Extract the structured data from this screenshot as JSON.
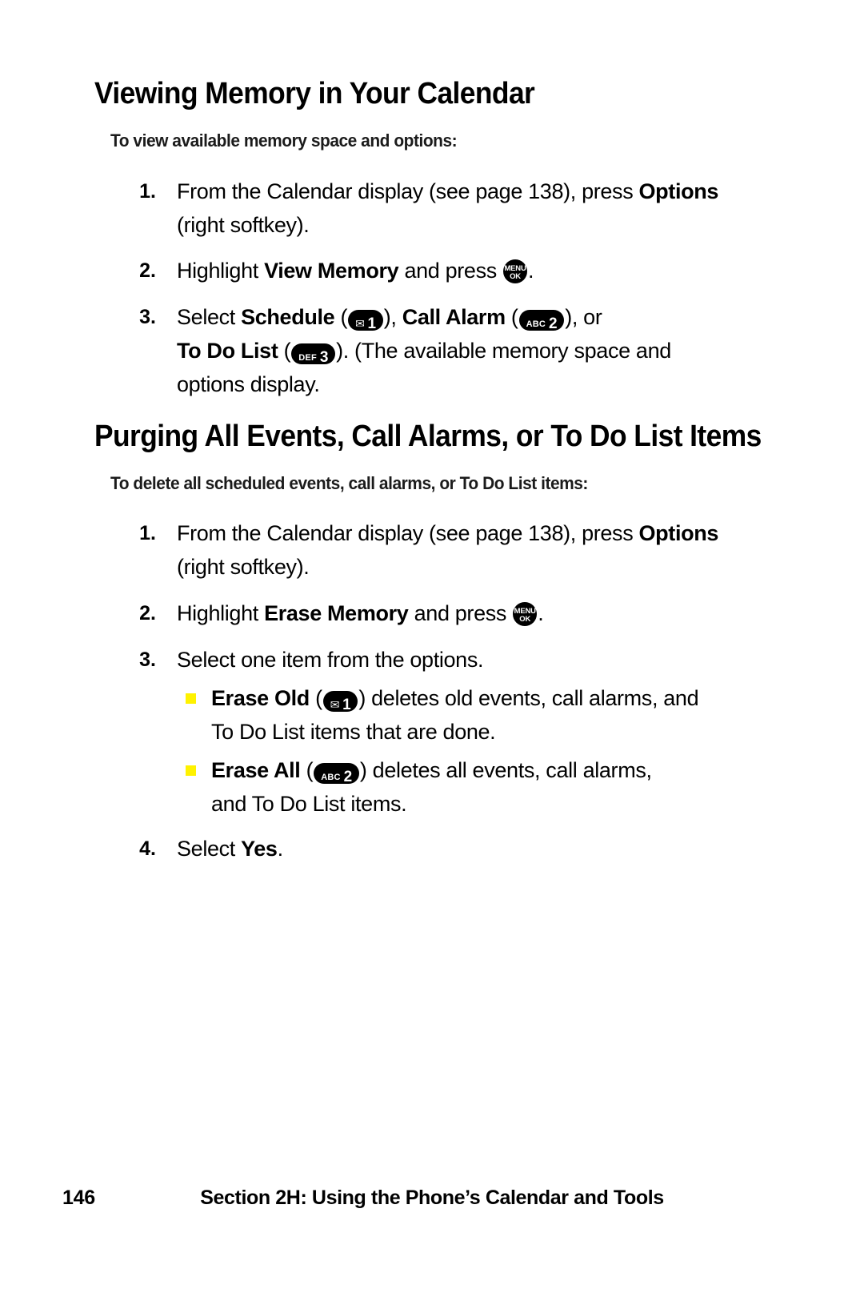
{
  "page": {
    "number": "146",
    "section_footer": "Section 2H: Using the Phone’s Calendar and Tools",
    "bullet_color": "#fff200"
  },
  "section1": {
    "heading": "Viewing Memory in Your Calendar",
    "subheading": "To view available memory space and options:",
    "steps": [
      {
        "number": "1.",
        "line1_a": "From the Calendar display (see page 138), press ",
        "line1_b": "Options",
        "line2": "(right softkey)."
      },
      {
        "number": "2.",
        "pre": "Highlight ",
        "bold": "View Memory",
        "mid": " and press ",
        "post": "."
      },
      {
        "number": "3.",
        "line1_pre": "Select ",
        "line1_bold": "Schedule",
        "line1_mid": " (",
        "line1_after_key1": "), ",
        "line1_bold2": "Call Alarm",
        "line1_mid2": " (",
        "line1_end": "), or",
        "line2_bold": "To Do List",
        "line2_mid": " (",
        "line2_after_key": "). (The available memory space and",
        "line3": "options display."
      }
    ]
  },
  "section2": {
    "heading": "Purging All Events, Call Alarms, or To Do List Items",
    "subheading": "To delete all scheduled events, call alarms, or To Do List items:",
    "steps": [
      {
        "number": "1.",
        "line1_a": "From the Calendar display (see page 138), press ",
        "line1_b": "Options",
        "line2": "(right softkey)."
      },
      {
        "number": "2.",
        "pre": "Highlight ",
        "bold": "Erase Memory",
        "mid": " and press ",
        "post": "."
      },
      {
        "number": "3.",
        "text": "Select one item from the options."
      },
      {
        "number": "4.",
        "pre": "Select ",
        "bold": "Yes",
        "post": "."
      }
    ],
    "bullets": [
      {
        "bold": "Erase Old",
        "mid": " (",
        "after_key": ") deletes old events, call alarms, and",
        "line2": "To Do List items that are done."
      },
      {
        "bold": "Erase All",
        "mid": " (",
        "after_key": ") deletes all events, call alarms,",
        "line2": "and To Do List items."
      }
    ]
  },
  "keys": {
    "envelope_glyph": "✉",
    "key1_digit": "1",
    "key2_label": "ABC",
    "key2_digit": "2",
    "key3_label": "DEF",
    "key3_digit": "3",
    "menu_line1": "MENU",
    "menu_line2": "OK"
  }
}
